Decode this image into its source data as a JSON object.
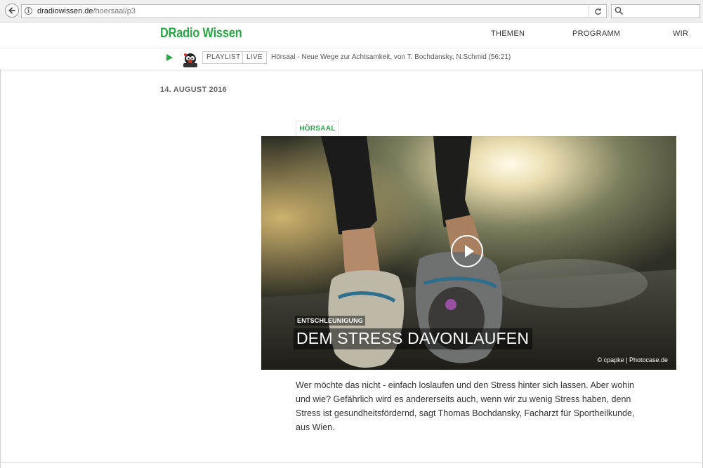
{
  "browser": {
    "url_domain": "dradiowissen.de",
    "url_path": "/hoersaal/p3",
    "search_placeholder": ""
  },
  "header": {
    "logo": "DRadio Wissen",
    "nav": [
      "THEMEN",
      "PROGRAMM",
      "WIR"
    ]
  },
  "player": {
    "playlist_label": "PLAYLIST",
    "live_label": "LIVE",
    "now_playing": "Hörsaal - Neue Wege zur Achtsamkeit, von T. Bochdansky, N.Schmid (56:21)"
  },
  "article": {
    "date": "14. AUGUST 2016",
    "category": "HÖRSAAL",
    "kicker": "ENTSCHLEUNIGUNG",
    "headline": "DEM STRESS DAVONLAUFEN",
    "credit": "© cpapke | Photocase.de",
    "teaser": "Wer möchte das nicht - einfach loslaufen und den Stress hinter sich lassen. Aber wohin und wie? Gefährlich wird es andererseits auch, wenn wir zu wenig Stress haben, denn Stress ist gesundheitsfördernd, sagt Thomas Bochdansky, Facharzt für Sportheilkunde, aus Wien."
  },
  "colors": {
    "brand_green": "#27a844",
    "text": "#333333"
  }
}
